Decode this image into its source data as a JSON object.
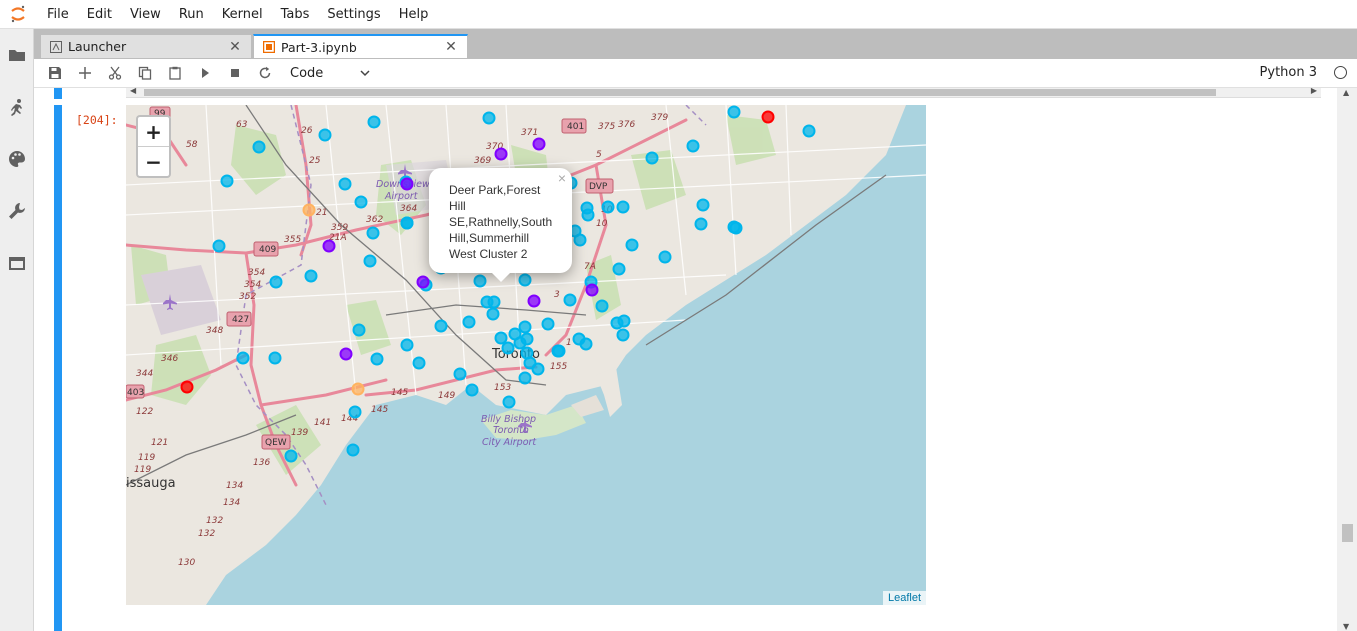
{
  "menu": [
    "File",
    "Edit",
    "View",
    "Run",
    "Kernel",
    "Tabs",
    "Settings",
    "Help"
  ],
  "tabs": [
    {
      "label": "Launcher",
      "icon": "launcher-icon",
      "active": false
    },
    {
      "label": "Part-3.ipynb",
      "icon": "notebook-icon",
      "active": true
    }
  ],
  "toolbar": {
    "cell_type": "Code",
    "kernel": "Python 3"
  },
  "cell": {
    "prompt": "[204]:"
  },
  "map": {
    "zoom_in": "+",
    "zoom_out": "−",
    "attribution": "Leaflet",
    "popup": {
      "close": "×",
      "lines": [
        "Deer Park,Forest",
        "Hill",
        "SE,Rathnelly,South",
        "Hill,Summerhill",
        "West Cluster 2"
      ]
    },
    "labels": {
      "mississauga": "issauga",
      "toronto": "Toronto",
      "downsview": "Downsview",
      "downsview_airport": "Airport",
      "billy_bishop_1": "Billy Bishop",
      "billy_bishop_2": "Toronto",
      "billy_bishop_3": "City Airport"
    },
    "route_shields": [
      "401",
      "409",
      "427",
      "QEW",
      "DVP",
      "99",
      "403"
    ],
    "cluster_colors": {
      "cluster_0": "#ff0000",
      "cluster_1": "#8000ff",
      "cluster_2": "#00b5eb",
      "cluster_4": "#ffb360"
    }
  }
}
